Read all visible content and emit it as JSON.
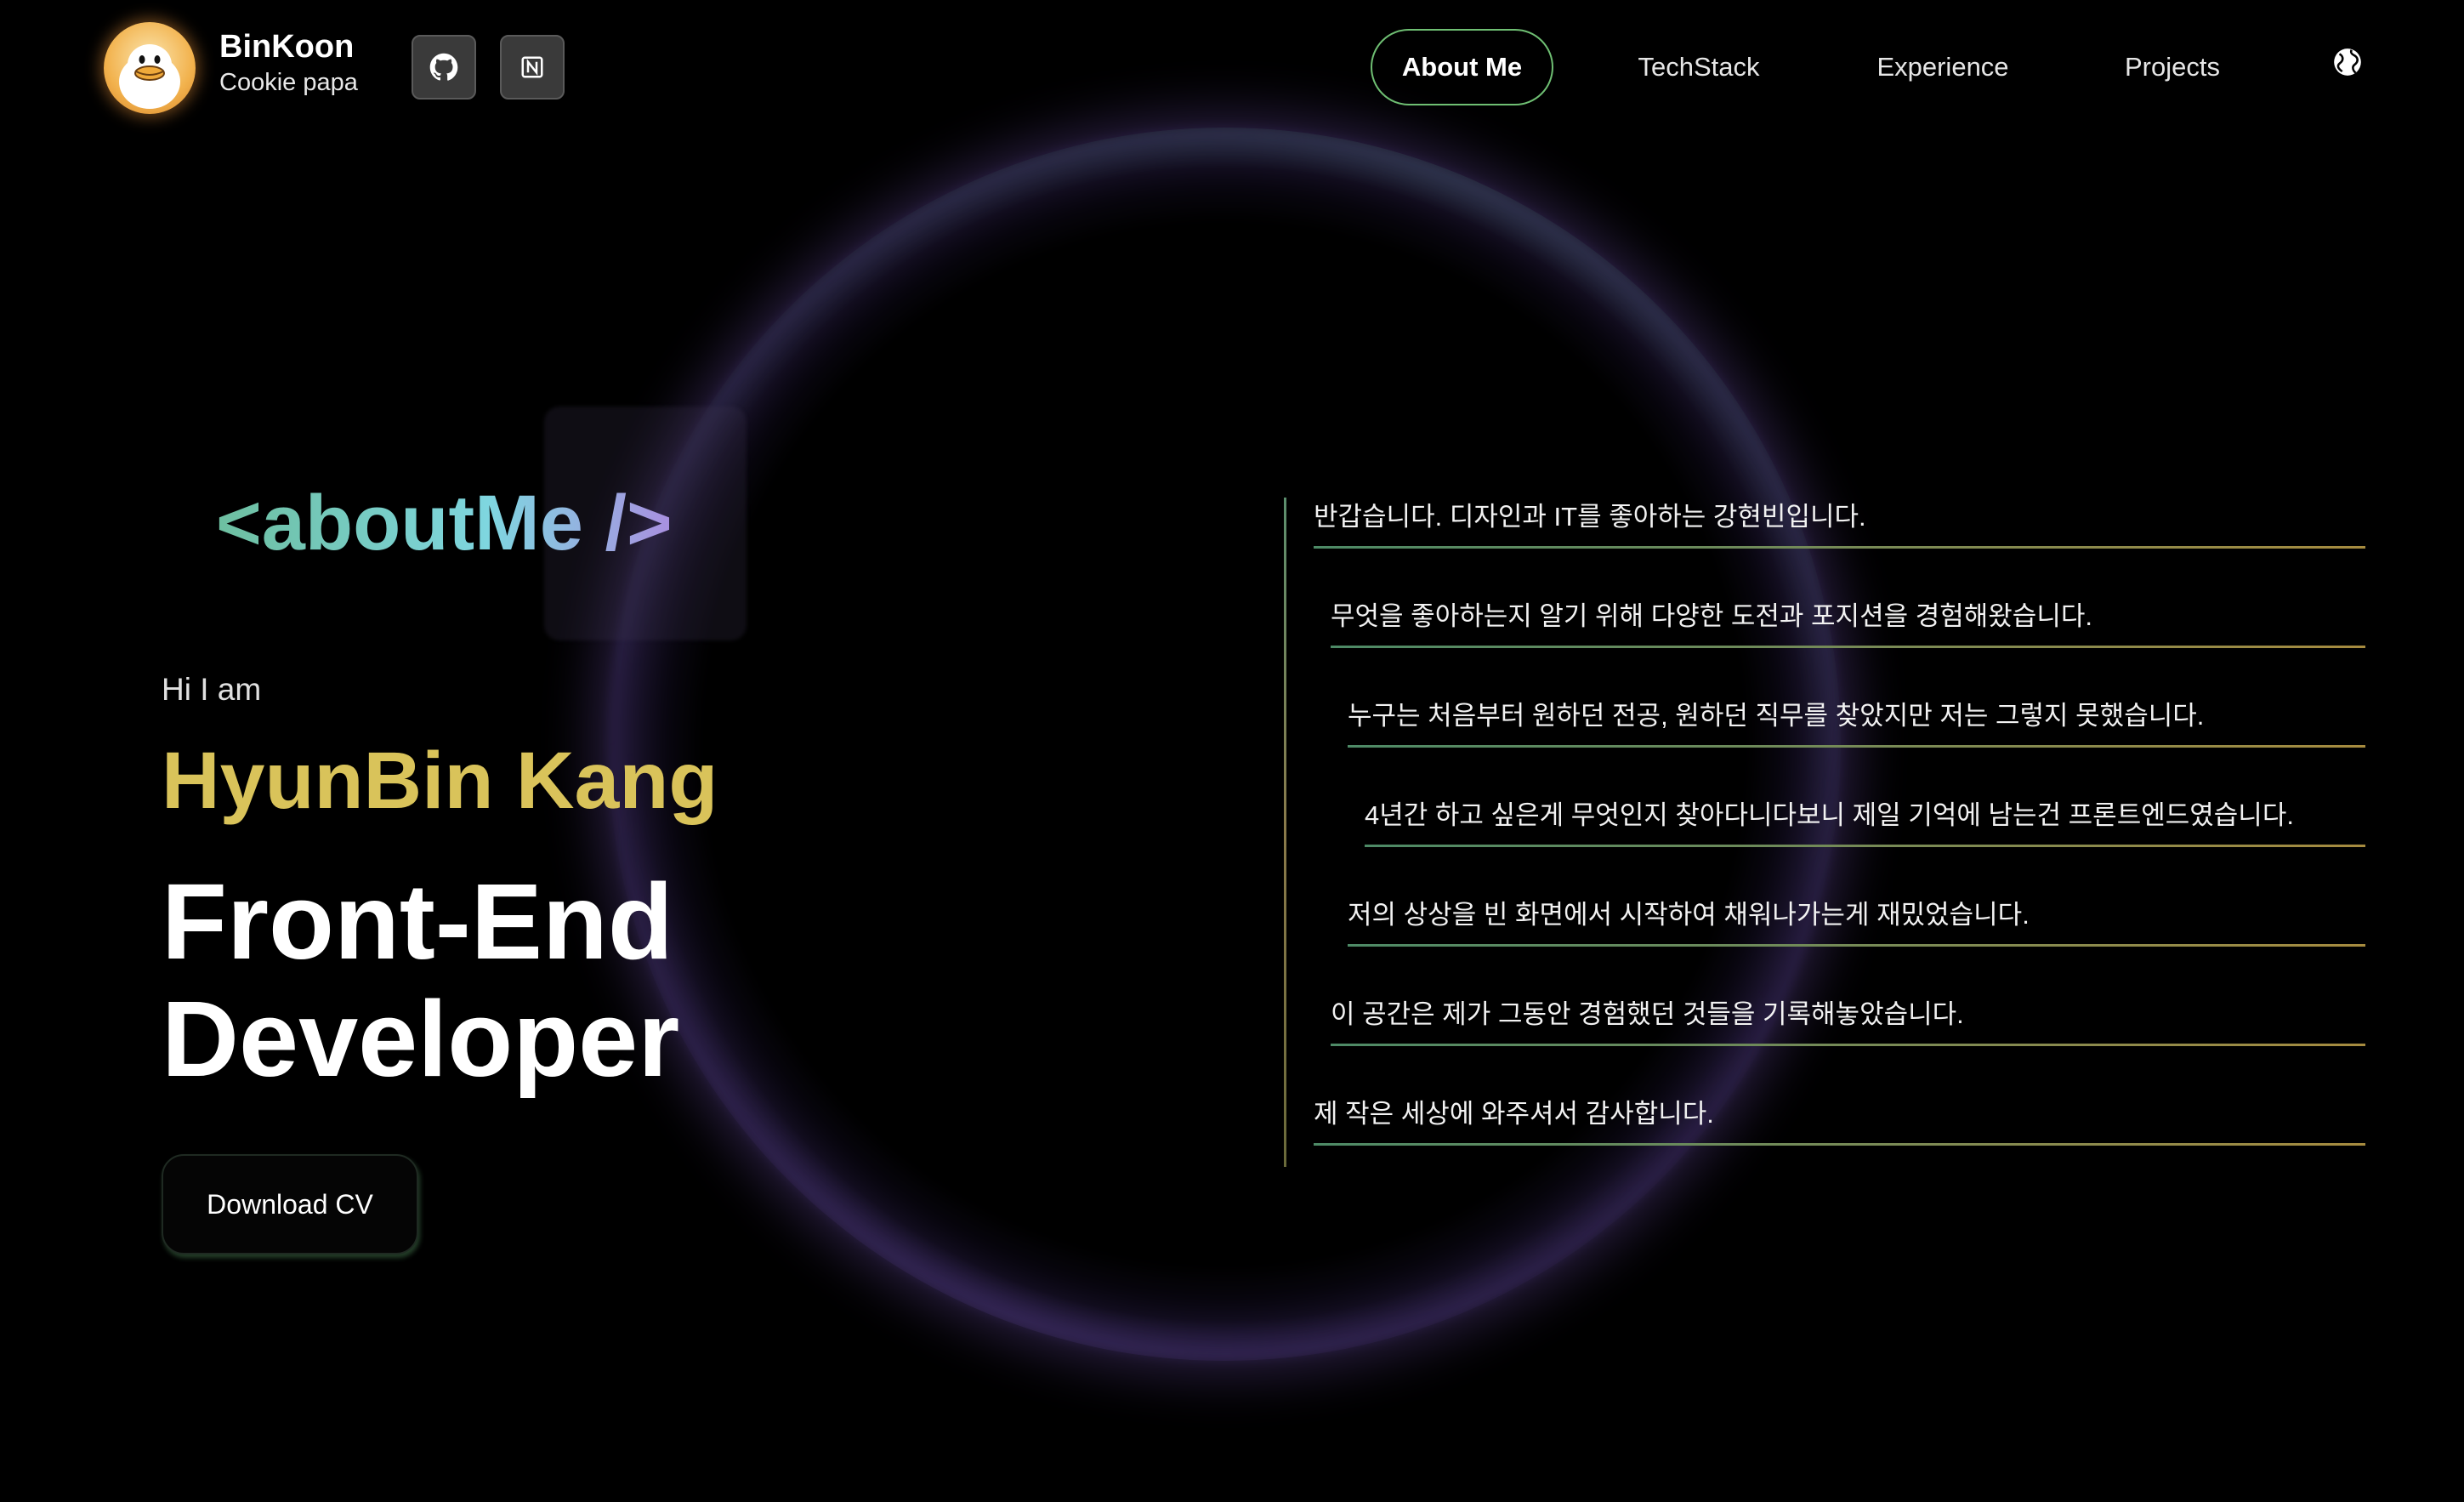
{
  "brand": {
    "name": "BinKoon",
    "subtitle": "Cookie papa"
  },
  "header_icons": {
    "github": "github-icon",
    "notion": "notion-icon",
    "language": "globe-icon"
  },
  "nav": {
    "items": [
      {
        "label": "About Me",
        "active": true
      },
      {
        "label": "TechStack",
        "active": false
      },
      {
        "label": "Experience",
        "active": false
      },
      {
        "label": "Projects",
        "active": false
      }
    ]
  },
  "hero": {
    "tag": "<aboutMe />",
    "greeting": "Hi I am",
    "name": "HyunBin Kang",
    "role_line1": "Front-End",
    "role_line2": "Developer",
    "cta_label": "Download CV"
  },
  "intro": {
    "lines": [
      "반갑습니다. 디자인과 IT를 좋아하는 강현빈입니다.",
      "무엇을 좋아하는지 알기 위해 다양한 도전과 포지션을 경험해왔습니다.",
      "누구는 처음부터 원하던 전공, 원하던 직무를 찾았지만 저는 그렇지 못했습니다.",
      "4년간 하고 싶은게 무엇인지 찾아다니다보니 제일 기억에 남는건 프론트엔드였습니다.",
      "저의 상상을 빈 화면에서 시작하여 채워나가는게 재밌었습니다.",
      "이 공간은 제가 그동안 경험했던 것들을 기록해놓았습니다.",
      "제 작은 세상에 와주셔서 감사합니다."
    ]
  },
  "colors": {
    "background": "#000000",
    "name_gold": "#d9c35a",
    "tag_teal": "#7fd6e0",
    "nav_active_border": "#6fbf73",
    "ring_purple": "#6e50aa"
  }
}
